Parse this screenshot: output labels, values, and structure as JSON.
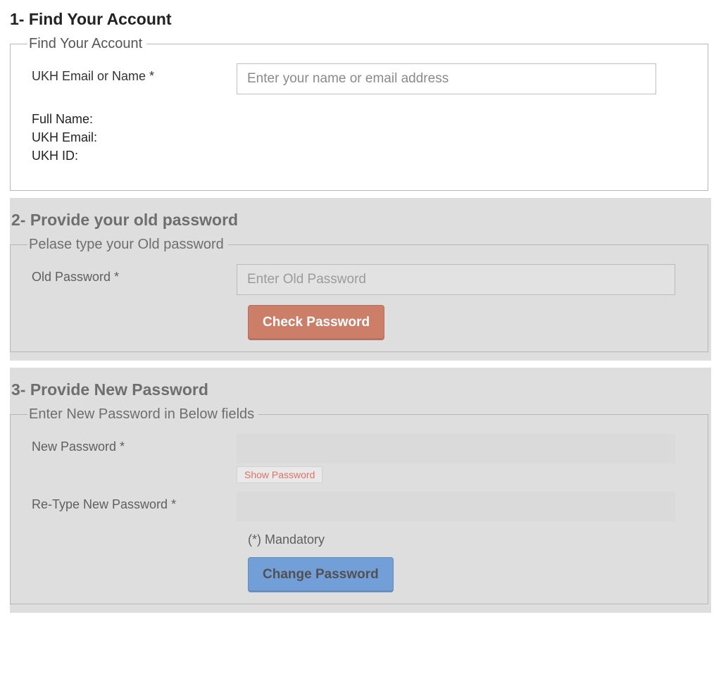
{
  "section1": {
    "title": "1- Find Your Account",
    "legend": "Find Your Account",
    "email_label": "UKH Email or Name *",
    "email_placeholder": "Enter your name or email address",
    "email_value": "",
    "info_fullname_label": "Full Name:",
    "info_fullname_value": "",
    "info_email_label": "UKH Email:",
    "info_email_value": "",
    "info_id_label": "UKH ID:",
    "info_id_value": ""
  },
  "section2": {
    "title": "2- Provide your old password",
    "legend": "Pelase type your Old password",
    "old_pw_label": "Old Password *",
    "old_pw_placeholder": "Enter Old Password",
    "old_pw_value": "",
    "check_btn": "Check Password"
  },
  "section3": {
    "title": "3- Provide New Password",
    "legend": "Enter New Password in Below fields",
    "new_pw_label": "New Password *",
    "new_pw_value": "",
    "show_pw": "Show Password",
    "retype_label": "Re-Type New Password *",
    "retype_value": "",
    "mandatory": "(*) Mandatory",
    "change_btn": "Change Password"
  }
}
